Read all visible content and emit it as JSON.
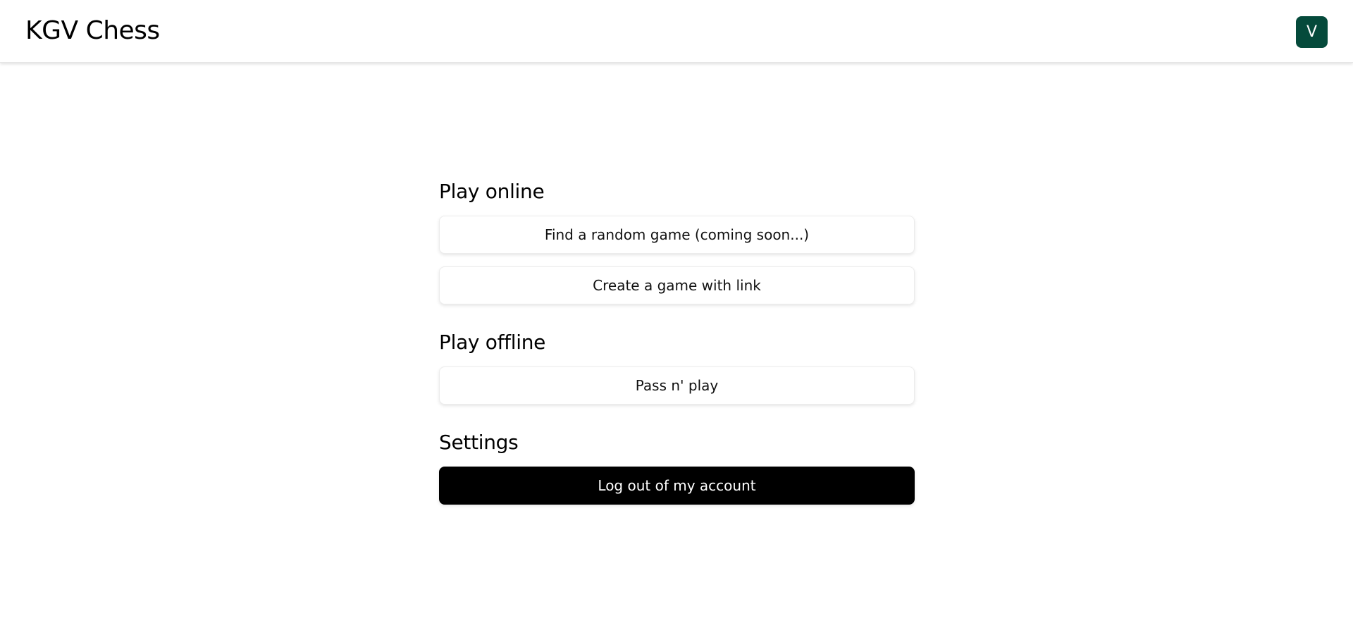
{
  "header": {
    "title": "KGV Chess",
    "avatar_initial": "V",
    "avatar_color": "#054a3b"
  },
  "sections": {
    "play_online": {
      "title": "Play online",
      "random_game_label": "Find a random game (coming soon...)",
      "link_game_label": "Create a game with link"
    },
    "play_offline": {
      "title": "Play offline",
      "pass_n_play_label": "Pass n' play"
    },
    "settings": {
      "title": "Settings",
      "logout_label": "Log out of my account"
    }
  }
}
